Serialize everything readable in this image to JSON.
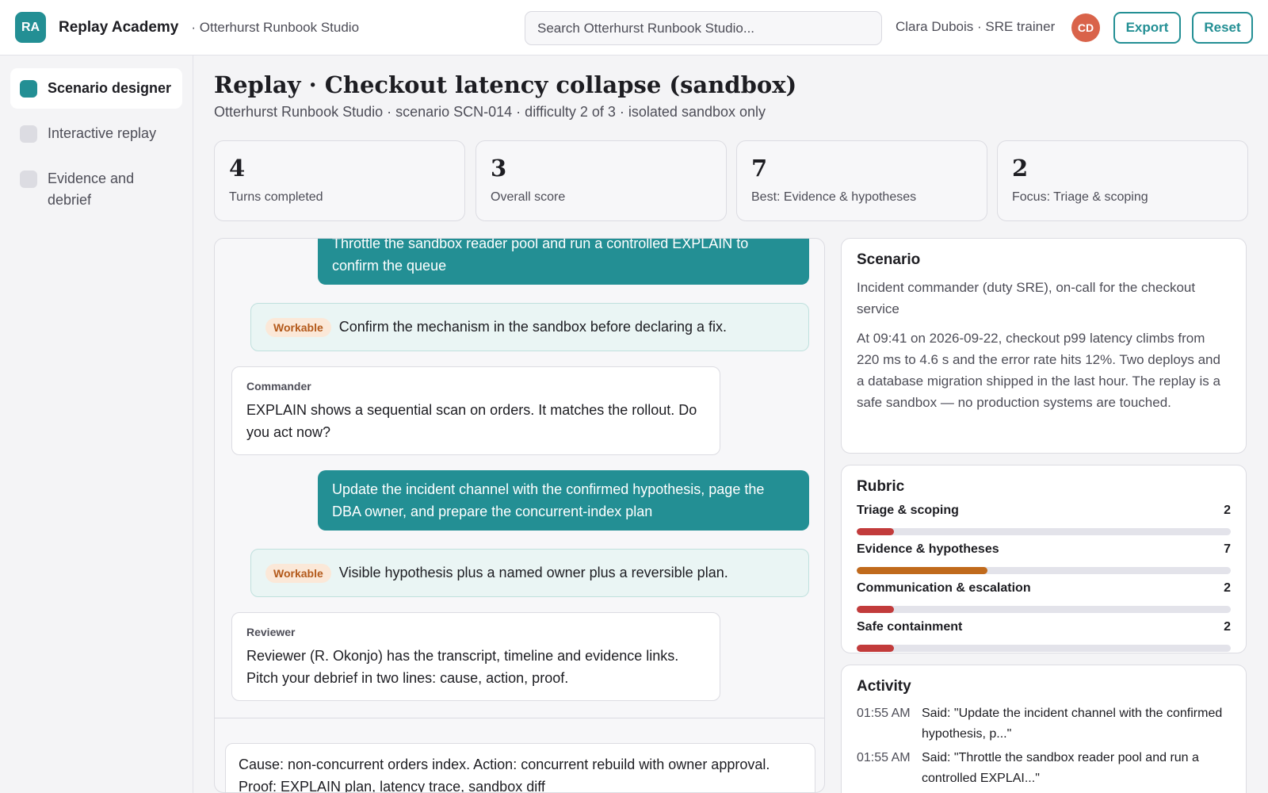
{
  "app": {
    "logo_initials": "RA",
    "brand": "Replay Academy",
    "workspace": "· Otterhurst Runbook Studio",
    "search_placeholder": "Search Otterhurst Runbook Studio...",
    "user": "Clara Dubois · SRE trainer",
    "avatar_initials": "CD",
    "export_label": "Export",
    "reset_label": "Reset"
  },
  "sidebar": {
    "items": [
      {
        "label": "Scenario designer",
        "active": true
      },
      {
        "label": "Interactive replay",
        "active": false
      },
      {
        "label": "Evidence and debrief",
        "active": false
      }
    ]
  },
  "page": {
    "title": "Replay · Checkout latency collapse (sandbox)",
    "subtitle": "Otterhurst Runbook Studio · scenario SCN-014 · difficulty 2 of 3 · isolated sandbox only"
  },
  "stats": [
    {
      "value": "4",
      "label": "Turns completed"
    },
    {
      "value": "3",
      "label": "Overall score"
    },
    {
      "value": "7",
      "label": "Best: Evidence & hypotheses"
    },
    {
      "value": "2",
      "label": "Focus: Triage & scoping"
    }
  ],
  "transcript": {
    "messages": [
      {
        "role": "user",
        "text": "Throttle the sandbox reader pool and run a controlled EXPLAIN to confirm the queue"
      },
      {
        "role": "feedback",
        "badge": "Workable",
        "text": "Confirm the mechanism in the sandbox before declaring a fix."
      },
      {
        "role": "npc",
        "speaker": "Commander",
        "text": "EXPLAIN shows a sequential scan on orders. It matches the rollout. Do you act now?"
      },
      {
        "role": "user",
        "text": "Update the incident channel with the confirmed hypothesis, page the DBA owner, and prepare the concurrent-index plan"
      },
      {
        "role": "feedback",
        "badge": "Workable",
        "text": "Visible hypothesis plus a named owner plus a reversible plan."
      },
      {
        "role": "npc",
        "speaker": "Reviewer",
        "text": "Reviewer (R. Okonjo) has the transcript, timeline and evidence links. Pitch your debrief in two lines: cause, action, proof."
      }
    ],
    "composer_value": "Cause: non-concurrent orders index. Action: concurrent rebuild with owner approval. Proof: EXPLAIN plan, latency trace, sandbox diff"
  },
  "scenario": {
    "title": "Scenario",
    "role": "Incident commander (duty SRE), on-call for the checkout service",
    "description": "At 09:41 on 2026-09-22, checkout p99 latency climbs from 220 ms to 4.6 s and the error rate hits 12%. Two deploys and a database migration shipped in the last hour. The replay is a safe sandbox — no production systems are touched."
  },
  "rubric": {
    "title": "Rubric",
    "max": 10,
    "items": [
      {
        "label": "Triage & scoping",
        "score": 2,
        "color": "#c23b3b"
      },
      {
        "label": "Evidence & hypotheses",
        "score": 7,
        "color": "#c06a1c"
      },
      {
        "label": "Communication & escalation",
        "score": 2,
        "color": "#c23b3b"
      },
      {
        "label": "Safe containment",
        "score": 2,
        "color": "#c23b3b"
      }
    ]
  },
  "activity": {
    "title": "Activity",
    "items": [
      {
        "time": "01:55 AM",
        "text": "Said: \"Update the incident channel with the confirmed hypothesis, p...\""
      },
      {
        "time": "01:55 AM",
        "text": "Said: \"Throttle the sandbox reader pool and run a controlled EXPLAI...\""
      }
    ]
  }
}
